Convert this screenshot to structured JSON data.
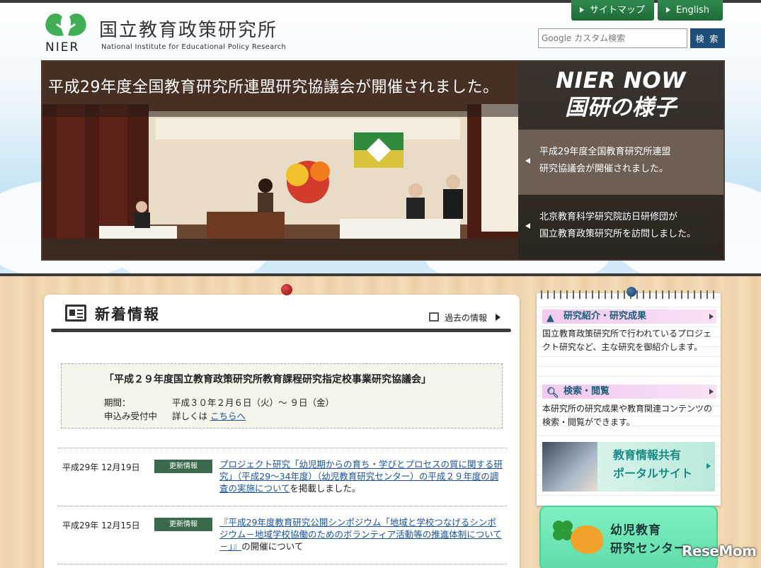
{
  "header": {
    "logo_nier": "NIER",
    "org_title": "国立教育政策研究所",
    "org_subtitle": "National Institute for Educational Policy Research",
    "sitemap_label": "サイトマップ",
    "english_label": "English",
    "search_placeholder": "Google カスタム検索",
    "search_button": "検 索"
  },
  "hero": {
    "caption": "平成29年度全国教育研究所連盟研究協議会が開催されました。",
    "side_title_line1": "NIER NOW",
    "side_title_line2": "国研の様子",
    "items": [
      {
        "line1": "平成29年度全国教育研究所連盟",
        "line2": "研究協議会が開催されました。"
      },
      {
        "line1": "北京教育科学研究院訪日研修団が",
        "line2": "国立教育政策研究所を訪問しました。"
      }
    ]
  },
  "news": {
    "title": "新着情報",
    "past_link": "過去の情報",
    "event": {
      "title": "「平成２９年度国立教育政策研究所教育課程研究指定校事業研究協議会」",
      "period_label": "期間：",
      "period_value": "平成３０年２月６日（火）～ ９日（金）",
      "apply_label": "申込み受付中",
      "detail_text": "詳しくは",
      "detail_link": "こちらへ"
    },
    "items": [
      {
        "date": "平成29年 12月19日",
        "badge": "更新情報",
        "link": "プロジェクト研究「幼児期からの育ち・学びとプロセスの質に関する研究」（平成29～34年度）（幼児教育研究センター）の平成２９年度の調査の実施について",
        "suffix": "を掲載しました。"
      },
      {
        "date": "平成29年 12月15日",
        "badge": "更新情報",
        "link": "『平成29年度教育研究公開シンポジウム「地域と学校つなげるシンポジウム－地域学校協働のためのボランティア活動等の推進体制について－」』",
        "suffix": "の開催について"
      }
    ]
  },
  "sidebar": {
    "research_head": "研究紹介・研究成果",
    "research_text": "国立教育政策研究所で行われているプロジェクト研究など、主な研究を御紹介します。",
    "search_head": "検索・閲覧",
    "search_text": "本研究所の研究成果や教育関連コンテンツの検索・閲覧ができます。",
    "portal_line1": "教育情報共有",
    "portal_line2": "ポータルサイト",
    "child_line1": "幼児教育",
    "child_line2": "研究センター"
  },
  "watermark": "ReseMom",
  "colors": {
    "header_green": "#2f8a4e",
    "search_blue": "#1f4e7a",
    "link_blue": "#1b53a0",
    "badge_green": "#3a6a4b"
  }
}
